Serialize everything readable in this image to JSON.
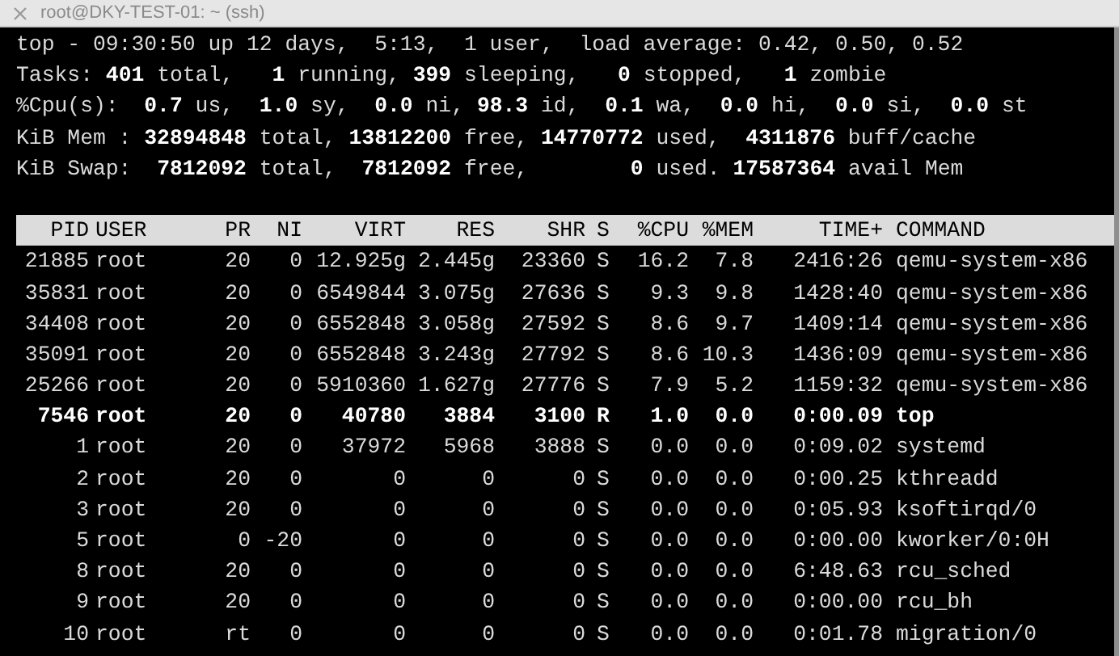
{
  "window": {
    "title": "root@DKY-TEST-01: ~ (ssh)"
  },
  "summary": [
    "top - 09:30:50 up 12 days,  5:13,  1 user,  load average: 0.42, 0.50, 0.52",
    "Tasks: **401** total,   **1** running, **399** sleeping,   **0** stopped,   **1** zombie",
    "%Cpu(s):  **0.7** us,  **1.0** sy,  **0.0** ni, **98.3** id,  **0.1** wa,  **0.0** hi,  **0.0** si,  **0.0** st",
    "KiB Mem : **32894848** total, **13812200** free, **14770772** used,  **4311876** buff/cache",
    "KiB Swap:  **7812092** total,  **7812092** free,        **0** used. **17587364** avail Mem"
  ],
  "table": {
    "columns": [
      "PID",
      "USER",
      "PR",
      "NI",
      "VIRT",
      "RES",
      "SHR",
      "S",
      "%CPU",
      "%MEM",
      "TIME+",
      "COMMAND"
    ],
    "rows": [
      {
        "highlighted": false,
        "cells": [
          "21885",
          "root",
          "20",
          "0",
          "12.925g",
          "2.445g",
          "23360",
          "S",
          "16.2",
          "7.8",
          "2416:26",
          "qemu-system-x86"
        ]
      },
      {
        "highlighted": false,
        "cells": [
          "35831",
          "root",
          "20",
          "0",
          "6549844",
          "3.075g",
          "27636",
          "S",
          "9.3",
          "9.8",
          "1428:40",
          "qemu-system-x86"
        ]
      },
      {
        "highlighted": false,
        "cells": [
          "34408",
          "root",
          "20",
          "0",
          "6552848",
          "3.058g",
          "27592",
          "S",
          "8.6",
          "9.7",
          "1409:14",
          "qemu-system-x86"
        ]
      },
      {
        "highlighted": false,
        "cells": [
          "35091",
          "root",
          "20",
          "0",
          "6552848",
          "3.243g",
          "27792",
          "S",
          "8.6",
          "10.3",
          "1436:09",
          "qemu-system-x86"
        ]
      },
      {
        "highlighted": false,
        "cells": [
          "25266",
          "root",
          "20",
          "0",
          "5910360",
          "1.627g",
          "27776",
          "S",
          "7.9",
          "5.2",
          "1159:32",
          "qemu-system-x86"
        ]
      },
      {
        "highlighted": true,
        "cells": [
          "7546",
          "root",
          "20",
          "0",
          "40780",
          "3884",
          "3100",
          "R",
          "1.0",
          "0.0",
          "0:00.09",
          "top"
        ]
      },
      {
        "highlighted": false,
        "cells": [
          "1",
          "root",
          "20",
          "0",
          "37972",
          "5968",
          "3888",
          "S",
          "0.0",
          "0.0",
          "0:09.02",
          "systemd"
        ]
      },
      {
        "highlighted": false,
        "cells": [
          "2",
          "root",
          "20",
          "0",
          "0",
          "0",
          "0",
          "S",
          "0.0",
          "0.0",
          "0:00.25",
          "kthreadd"
        ]
      },
      {
        "highlighted": false,
        "cells": [
          "3",
          "root",
          "20",
          "0",
          "0",
          "0",
          "0",
          "S",
          "0.0",
          "0.0",
          "0:05.93",
          "ksoftirqd/0"
        ]
      },
      {
        "highlighted": false,
        "cells": [
          "5",
          "root",
          "0",
          "-20",
          "0",
          "0",
          "0",
          "S",
          "0.0",
          "0.0",
          "0:00.00",
          "kworker/0:0H"
        ]
      },
      {
        "highlighted": false,
        "cells": [
          "8",
          "root",
          "20",
          "0",
          "0",
          "0",
          "0",
          "S",
          "0.0",
          "0.0",
          "6:48.63",
          "rcu_sched"
        ]
      },
      {
        "highlighted": false,
        "cells": [
          "9",
          "root",
          "20",
          "0",
          "0",
          "0",
          "0",
          "S",
          "0.0",
          "0.0",
          "0:00.00",
          "rcu_bh"
        ]
      },
      {
        "highlighted": false,
        "cells": [
          "10",
          "root",
          "rt",
          "0",
          "0",
          "0",
          "0",
          "S",
          "0.0",
          "0.0",
          "0:01.78",
          "migration/0"
        ]
      }
    ]
  }
}
